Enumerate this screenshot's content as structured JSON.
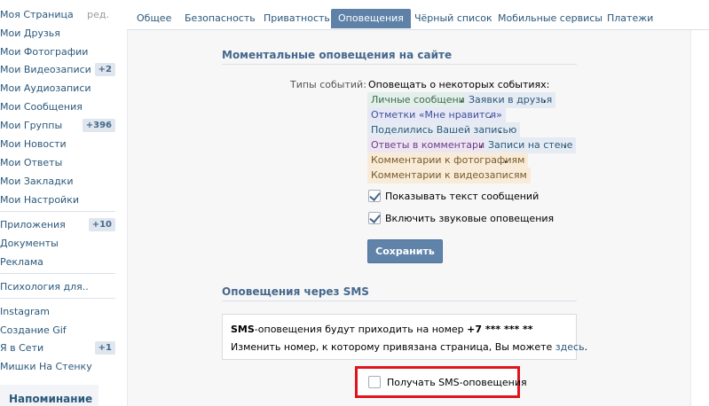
{
  "sidebar": {
    "items": [
      {
        "label": "Моя Страница",
        "extra": "ред."
      },
      {
        "label": "Мои Друзья"
      },
      {
        "label": "Мои Фотографии"
      },
      {
        "label": "Мои Видеозаписи",
        "badge": "+2"
      },
      {
        "label": "Мои Аудиозаписи"
      },
      {
        "label": "Мои Сообщения"
      },
      {
        "label": "Мои Группы",
        "badge": "+396"
      },
      {
        "label": "Мои Новости"
      },
      {
        "label": "Мои Ответы"
      },
      {
        "label": "Мои Закладки"
      },
      {
        "label": "Мои Настройки"
      },
      {
        "label": "Приложения",
        "badge": "+10"
      },
      {
        "label": "Документы"
      },
      {
        "label": "Реклама"
      },
      {
        "label": "Психология для.."
      },
      {
        "label": "Instagram"
      },
      {
        "label": "Создание Gif"
      },
      {
        "label": "Я в Сети",
        "badge": "+1"
      },
      {
        "label": "Мишки На Стенку"
      }
    ],
    "reminder": "Напоминание"
  },
  "tabs": [
    "Общее",
    "Безопасность",
    "Приватность",
    "Оповещения",
    "Чёрный список",
    "Мобильные сервисы",
    "Платежи"
  ],
  "active_tab": "Оповещения",
  "instant": {
    "title": "Моментальные оповещения на сайте",
    "field_label": "Типы событий:",
    "intro": "Оповещать о некоторых событиях:",
    "tags": [
      {
        "text": "Личные сообщения",
        "color": "#e3efe9"
      },
      {
        "text": "Заявки в друзья",
        "color": "#e5ebf3"
      },
      {
        "text": "Отметки «Мне нравится»",
        "color": "#e6e9f5"
      },
      {
        "text": "Поделились Вашей записью",
        "color": "#e5ebf3"
      },
      {
        "text": "Ответы в комментариях",
        "color": "#eee5f3"
      },
      {
        "text": "Записи на стене",
        "color": "#e5ebf3"
      },
      {
        "text": "Комментарии к фотографиям",
        "color": "#f8ecd9"
      },
      {
        "text": "Комментарии к видеозаписям",
        "color": "#f8ecd9"
      }
    ],
    "comma": ",",
    "show_text": {
      "label": "Показывать текст сообщений",
      "checked": true
    },
    "sound": {
      "label": "Включить звуковые оповещения",
      "checked": true
    },
    "save_label": "Сохранить"
  },
  "sms": {
    "title": "Оповещения через SMS",
    "line1_bold": "SMS",
    "line1_text": "-оповещения будут приходить на номер ",
    "phone": "+7 *** *** **",
    "line2_text": "Изменить номер, к которому привязана страница, Вы можете ",
    "line2_link": "здесь",
    "line2_end": ".",
    "receive": {
      "label": "Получать SMS-оповещения",
      "checked": false
    }
  }
}
